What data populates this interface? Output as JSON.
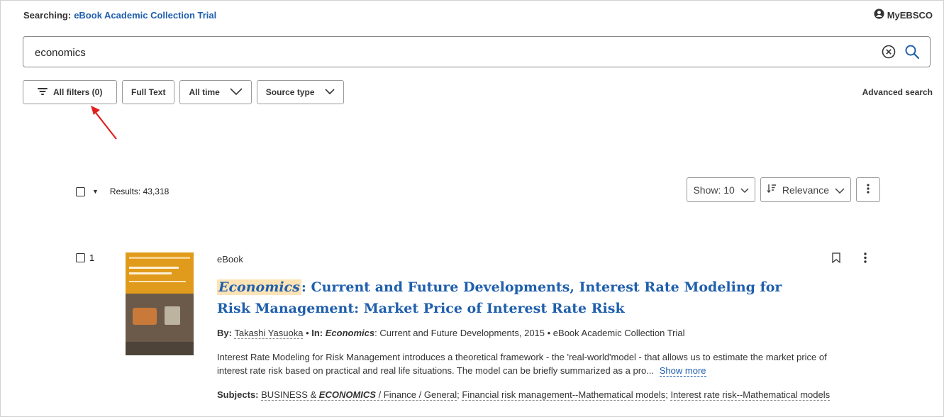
{
  "header": {
    "searching_label": "Searching:",
    "database": "eBook Academic Collection Trial",
    "myebsco": "MyEBSCO"
  },
  "search": {
    "query": "economics"
  },
  "filters": {
    "all_filters": "All filters (0)",
    "full_text": "Full Text",
    "all_time": "All time",
    "source_type": "Source type",
    "advanced_search": "Advanced search"
  },
  "results": {
    "count_label": "Results: 43,318",
    "show": "Show: 10",
    "sort": "Relevance"
  },
  "item": {
    "number": "1",
    "pub_type": "eBook",
    "title_highlight": "Economics",
    "title_rest": ": Current and Future Developments, Interest Rate Modeling for Risk Management: Market Price of Interest Rate Risk",
    "by_label": "By:",
    "author": "Takashi Yasuoka",
    "in_label": "In:",
    "source_highlight": "Economics",
    "source_rest": ": Current and Future Developments, 2015 • eBook Academic Collection Trial",
    "abstract": "Interest Rate Modeling for Risk Management introduces a theoretical framework - the 'real-world'model - that allows us to estimate the market price of interest rate risk based on practical and real life situations. The model can be briefly summarized as a pro...",
    "show_more": "Show more",
    "subjects_label": "Subjects:",
    "subject1_pre": "BUSINESS & ",
    "subject1_hl": "ECONOMICS",
    "subject1_post": " / Finance / General",
    "subject2": "Financial risk management--Mathematical models",
    "subject3": "Interest rate risk--Mathematical models"
  }
}
